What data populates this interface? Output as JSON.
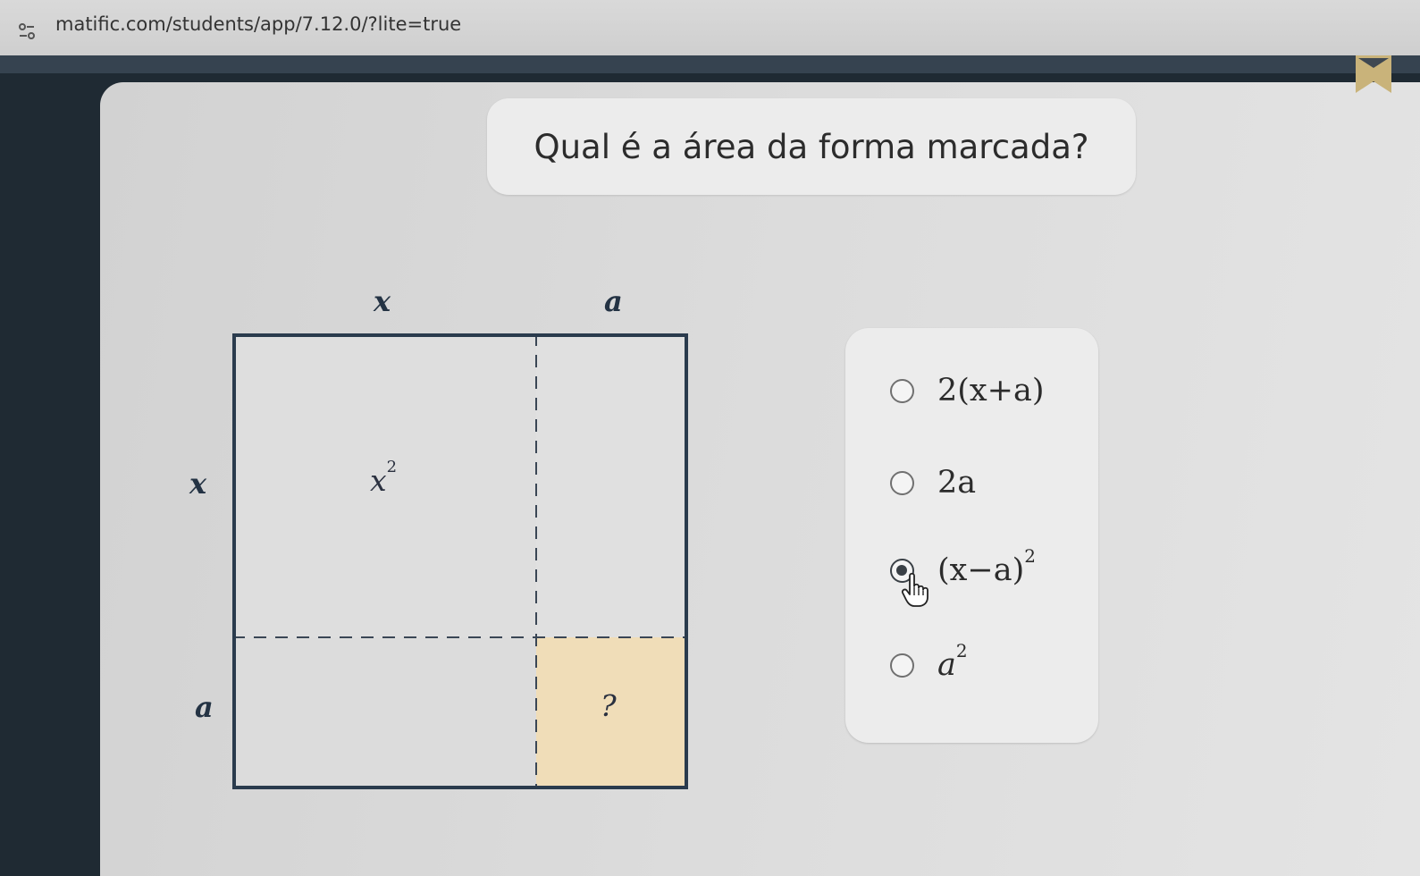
{
  "browser": {
    "url": "matific.com/students/app/7.12.0/?lite=true",
    "site_icon": "page-settings-icon"
  },
  "activity": {
    "bookmark_icon": "bookmark-ribbon-icon",
    "question": "Qual é a área da forma marcada?",
    "diagram": {
      "top_labels": [
        "x",
        "a"
      ],
      "side_labels": [
        "x",
        "a"
      ],
      "region_x2_base": "x",
      "region_x2_exp": "2",
      "unknown_label": "?",
      "highlight_color": "#f0ddb8",
      "border_color": "#2a3b4d"
    },
    "options": [
      {
        "id": "opt1",
        "text": "2(x+a)",
        "selected": false
      },
      {
        "id": "opt2",
        "text": "2a",
        "selected": false
      },
      {
        "id": "opt3",
        "base": "(x−a)",
        "exp": "2",
        "selected": true
      },
      {
        "id": "opt4",
        "base": "a",
        "exp": "2",
        "selected": false
      }
    ],
    "cursor_icon": "hand-pointer-icon"
  }
}
